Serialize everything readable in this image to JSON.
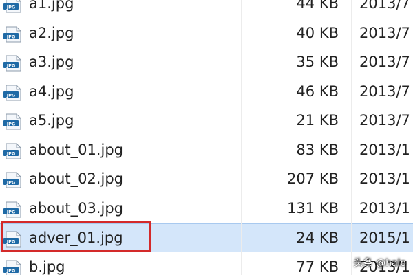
{
  "files": [
    {
      "name": "a1.jpg",
      "size": "44 KB",
      "date": "2013/7"
    },
    {
      "name": "a2.jpg",
      "size": "40 KB",
      "date": "2013/7"
    },
    {
      "name": "a3.jpg",
      "size": "35 KB",
      "date": "2013/7"
    },
    {
      "name": "a4.jpg",
      "size": "46 KB",
      "date": "2013/7"
    },
    {
      "name": "a5.jpg",
      "size": "21 KB",
      "date": "2013/7"
    },
    {
      "name": "about_01.jpg",
      "size": "83 KB",
      "date": "2013/1"
    },
    {
      "name": "about_02.jpg",
      "size": "207 KB",
      "date": "2013/1"
    },
    {
      "name": "about_03.jpg",
      "size": "131 KB",
      "date": "2013/1"
    },
    {
      "name": "adver_01.jpg",
      "size": "24 KB",
      "date": "2015/1"
    },
    {
      "name": "b.jpg",
      "size": "77 KB",
      "date": "2013/1"
    }
  ],
  "selected_file": "adver_01.jpg",
  "file_icon": "jpg-file-icon",
  "icon_text": "JPG",
  "watermark": "头条 @halo",
  "colors": {
    "selection": "#d4e6fa",
    "highlight_box": "#d42a2a",
    "icon_body": "#1f6aa6"
  }
}
